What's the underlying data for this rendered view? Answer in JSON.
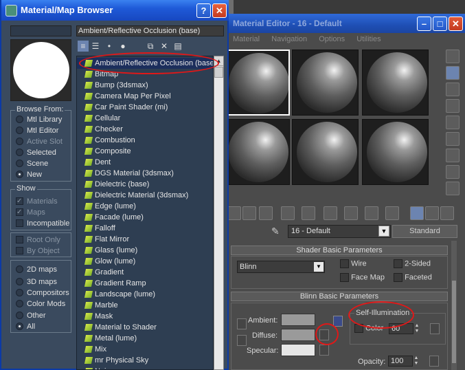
{
  "material_editor": {
    "title": "Material Editor - 16 - Default",
    "menu": [
      "Material",
      "Navigation",
      "Options",
      "Utilities"
    ],
    "material_name": "16 - Default",
    "material_type": "Standard",
    "shader_rollout": "Shader Basic Parameters",
    "shader_type": "Blinn",
    "shader_options": [
      {
        "label": "Wire",
        "checked": false
      },
      {
        "label": "2-Sided",
        "checked": false
      },
      {
        "label": "Face Map",
        "checked": false
      },
      {
        "label": "Faceted",
        "checked": false
      }
    ],
    "blinn_rollout": "Blinn Basic Parameters",
    "self_illumination": {
      "group_label": "Self-Illumination",
      "color_label": "Color",
      "value": "60"
    },
    "color_labels": {
      "ambient": "Ambient:",
      "diffuse": "Diffuse:",
      "specular": "Specular:"
    },
    "opacity": {
      "label": "Opacity:",
      "value": "100"
    }
  },
  "browser": {
    "title": "Material/Map Browser",
    "help_btn": "?",
    "close_btn": "✕",
    "path": "Ambient/Reflective Occlusion (base)",
    "browse_from": {
      "title": "Browse From:",
      "options": [
        {
          "label": "Mtl Library",
          "on": false,
          "disabled": false
        },
        {
          "label": "Mtl Editor",
          "on": false,
          "disabled": false
        },
        {
          "label": "Active Slot",
          "on": false,
          "disabled": true
        },
        {
          "label": "Selected",
          "on": false,
          "disabled": false
        },
        {
          "label": "Scene",
          "on": false,
          "disabled": false
        },
        {
          "label": "New",
          "on": true,
          "disabled": false
        }
      ]
    },
    "show": {
      "title": "Show",
      "options": [
        {
          "label": "Materials",
          "on": true,
          "disabled": true
        },
        {
          "label": "Maps",
          "on": true,
          "disabled": true
        },
        {
          "label": "Incompatible",
          "on": false,
          "disabled": false
        }
      ]
    },
    "filter": {
      "options": [
        {
          "label": "Root Only",
          "on": false,
          "disabled": true
        },
        {
          "label": "By Object",
          "on": false,
          "disabled": true
        }
      ]
    },
    "map_types": {
      "options": [
        {
          "label": "2D maps",
          "on": false
        },
        {
          "label": "3D maps",
          "on": false
        },
        {
          "label": "Compositors",
          "on": false
        },
        {
          "label": "Color Mods",
          "on": false
        },
        {
          "label": "Other",
          "on": false
        },
        {
          "label": "All",
          "on": true
        }
      ]
    },
    "items": [
      "Ambient/Reflective Occlusion (base",
      "Bitmap",
      "Bump (3dsmax)",
      "Camera Map Per Pixel",
      "Car Paint Shader (mi)",
      "Cellular",
      "Checker",
      "Combustion",
      "Composite",
      "Dent",
      "DGS Material (3dsmax)",
      "Dielectric (base)",
      "Dielectric Material (3dsmax)",
      "Edge (lume)",
      "Facade (lume)",
      "Falloff",
      "Flat Mirror",
      "Glass (lume)",
      "Glow (lume)",
      "Gradient",
      "Gradient Ramp",
      "Landscape (lume)",
      "Marble",
      "Mask",
      "Material to Shader",
      "Metal (lume)",
      "Mix",
      "mr Physical Sky",
      "Noise"
    ],
    "selected_index": 0
  }
}
